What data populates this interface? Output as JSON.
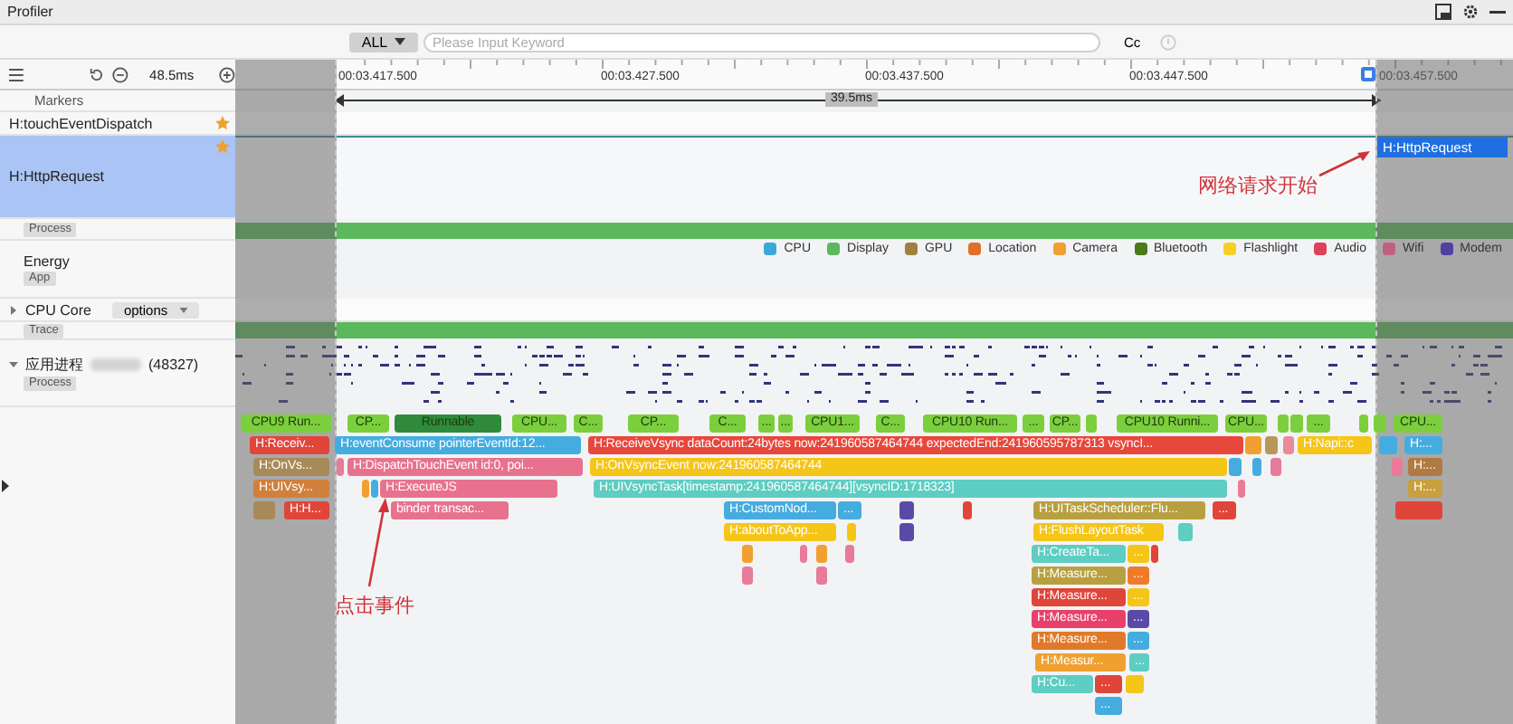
{
  "window": {
    "title": "Profiler"
  },
  "toolbar": {
    "filter": "ALL",
    "search": {
      "placeholder": "Please Input Keyword"
    },
    "case_toggle": "Cc"
  },
  "timeline": {
    "zoom": "48.5ms",
    "ticks": [
      "00:03.417.500",
      "00:03.427.500",
      "00:03.437.500",
      "00:03.447.500",
      "00:03.457.500"
    ],
    "range": "39.5ms"
  },
  "markers": {
    "title": "Markers",
    "items": [
      {
        "label": "H:touchEventDispatch",
        "selected": false
      },
      {
        "label": "H:HttpRequest",
        "selected": true
      }
    ],
    "flag": "H:HttpRequest"
  },
  "annotations": [
    {
      "text": "网络请求开始"
    },
    {
      "text": "点击事件"
    }
  ],
  "process": {
    "tag": "Process"
  },
  "energy": {
    "title": "Energy",
    "tag": "App",
    "legend": [
      {
        "label": "CPU",
        "color": "#3aa8d8"
      },
      {
        "label": "Display",
        "color": "#5cb85c"
      },
      {
        "label": "GPU",
        "color": "#a08040"
      },
      {
        "label": "Location",
        "color": "#e0702a"
      },
      {
        "label": "Camera",
        "color": "#f0a030"
      },
      {
        "label": "Bluetooth",
        "color": "#4a7a1a"
      },
      {
        "label": "Flashlight",
        "color": "#f5d020"
      },
      {
        "label": "Audio",
        "color": "#e0405a"
      },
      {
        "label": "Wifi",
        "color": "#c06080"
      },
      {
        "label": "Modem",
        "color": "#5040a0"
      }
    ]
  },
  "cpu_core": {
    "title": "CPU Core",
    "options": "options",
    "tag": "Trace",
    "expanded": false
  },
  "app_process": {
    "title": "应用进程",
    "pid": "(48327)",
    "tag": "Process",
    "expanded": true
  },
  "flame_rows": [
    {
      "kind": "cpu",
      "slices": [
        {
          "label": "CPU9 Run...",
          "color": "#7ccf3c"
        },
        {
          "label": "CP...",
          "color": "#7ccf3c"
        },
        {
          "label": "Runnable",
          "color": "#2f8a3c"
        },
        {
          "label": "CPU...",
          "color": "#7ccf3c"
        },
        {
          "label": "C...",
          "color": "#7ccf3c"
        },
        {
          "label": "CP...",
          "color": "#7ccf3c"
        },
        {
          "label": "C...",
          "color": "#7ccf3c"
        },
        {
          "label": "...",
          "color": "#7ccf3c"
        },
        {
          "label": "...",
          "color": "#7ccf3c"
        },
        {
          "label": "CPU1...",
          "color": "#7ccf3c"
        },
        {
          "label": "C...",
          "color": "#7ccf3c"
        },
        {
          "label": "CPU10 Run...",
          "color": "#7ccf3c"
        },
        {
          "label": "...",
          "color": "#7ccf3c"
        },
        {
          "label": "CP...",
          "color": "#7ccf3c"
        },
        {
          "color": "#7ccf3c"
        },
        {
          "label": "CPU10 Runni...",
          "color": "#7ccf3c"
        },
        {
          "label": "CPU...",
          "color": "#7ccf3c"
        },
        {
          "color": "#7ccf3c"
        },
        {
          "color": "#7ccf3c"
        },
        {
          "label": "...",
          "color": "#7ccf3c"
        },
        {
          "color": "#7ccf3c"
        },
        {
          "color": "#7ccf3c"
        },
        {
          "label": "CPU...",
          "color": "#7ccf3c"
        }
      ]
    },
    {
      "kind": "call",
      "slices": [
        {
          "label": "H:Receiv...",
          "color": "#e0453a"
        },
        {
          "label": "H:eventConsume pointerEventId:12...",
          "color": "#45ace0"
        },
        {
          "label": "H:ReceiveVsync dataCount:24bytes now:241960587464744 expectedEnd:241960595787313 vsyncI...",
          "color": "#e8473c"
        },
        {
          "color": "#f0a030"
        },
        {
          "color": "#b8955a"
        },
        {
          "color": "#e88a9a"
        },
        {
          "label": "H:Napi::c",
          "color": "#f5c518"
        },
        {
          "color": "#45ace0"
        },
        {
          "label": "H:...",
          "color": "#45ace0"
        }
      ]
    },
    {
      "kind": "call",
      "slices": [
        {
          "label": "H:OnVs...",
          "color": "#a88a58"
        },
        {
          "color": "#e87a9a"
        },
        {
          "label": "H:DispatchTouchEvent id:0, poi...",
          "color": "#e8728e"
        },
        {
          "label": "H:OnVsyncEvent now:241960587464744",
          "color": "#f5c518"
        },
        {
          "color": "#45ace0"
        },
        {
          "color": "#45ace0"
        },
        {
          "color": "#e87a9a"
        },
        {
          "color": "#e87a9a"
        },
        {
          "label": "H:...",
          "color": "#b07a40"
        }
      ]
    },
    {
      "kind": "call",
      "slices": [
        {
          "label": "H:UIVsy...",
          "color": "#d0803c"
        },
        {
          "color": "#f0a030"
        },
        {
          "color": "#45ace0"
        },
        {
          "label": "H:ExecuteJS",
          "color": "#e8728e"
        },
        {
          "label": "H:UIVsyncTask[timestamp:241960587464744][vsyncID:1718323]",
          "color": "#5ecdc2"
        },
        {
          "color": "#e87a9a"
        },
        {
          "label": "H:...",
          "color": "#c8a040"
        }
      ]
    },
    {
      "kind": "call",
      "slices": [
        {
          "color": "#a88a58"
        },
        {
          "label": "H:H...",
          "color": "#e0453a"
        },
        {
          "label": "binder transac...",
          "color": "#e8728e"
        },
        {
          "label": "H:CustomNod...",
          "color": "#45ace0"
        },
        {
          "label": "...",
          "color": "#45ace0"
        },
        {
          "color": "#5a4aa8"
        },
        {
          "color": "#e0453a"
        },
        {
          "label": "H:UITaskScheduler::Flu...",
          "color": "#b8a040"
        },
        {
          "label": "...",
          "color": "#e0453a"
        },
        {
          "color": "#e0453a"
        }
      ]
    },
    {
      "kind": "call",
      "slices": [
        {
          "label": "H:aboutToApp...",
          "color": "#f5c518"
        },
        {
          "color": "#f5c518"
        },
        {
          "color": "#5a4aa8"
        },
        {
          "label": "H:FlushLayoutTask",
          "color": "#f5c518"
        },
        {
          "color": "#5ecdc2"
        }
      ]
    },
    {
      "kind": "call",
      "slices": [
        {
          "color": "#f0a030"
        },
        {
          "color": "#e87a9a"
        },
        {
          "color": "#f0a030"
        },
        {
          "color": "#e87a9a"
        },
        {
          "label": "H:CreateTa...",
          "color": "#5ecdc2"
        },
        {
          "label": "...",
          "color": "#f5c518"
        },
        {
          "color": "#e0453a"
        }
      ]
    },
    {
      "kind": "call",
      "slices": [
        {
          "color": "#e87a9a"
        },
        {
          "color": "#e87a9a"
        },
        {
          "label": "H:Measure...",
          "color": "#b8a040"
        },
        {
          "label": "...",
          "color": "#f07a2a"
        }
      ]
    },
    {
      "kind": "call",
      "slices": [
        {
          "label": "H:Measure...",
          "color": "#e0453a"
        },
        {
          "label": "...",
          "color": "#f5c518"
        }
      ]
    },
    {
      "kind": "call",
      "slices": [
        {
          "label": "H:Measure...",
          "color": "#e8406a"
        },
        {
          "label": "...",
          "color": "#5a4aa8"
        }
      ]
    },
    {
      "kind": "call",
      "slices": [
        {
          "label": "H:Measure...",
          "color": "#e07a2a"
        },
        {
          "label": "...",
          "color": "#45ace0"
        }
      ]
    },
    {
      "kind": "call",
      "slices": [
        {
          "label": "H:Measur...",
          "color": "#f0a030"
        },
        {
          "label": "...",
          "color": "#5ecdc2"
        }
      ]
    },
    {
      "kind": "call",
      "slices": [
        {
          "label": "H:Cu...",
          "color": "#5ecdc2"
        },
        {
          "label": "...",
          "color": "#e0453a"
        },
        {
          "color": "#f5c518"
        }
      ]
    },
    {
      "kind": "call",
      "slices": [
        {
          "label": "...",
          "color": "#45ace0"
        }
      ]
    }
  ]
}
